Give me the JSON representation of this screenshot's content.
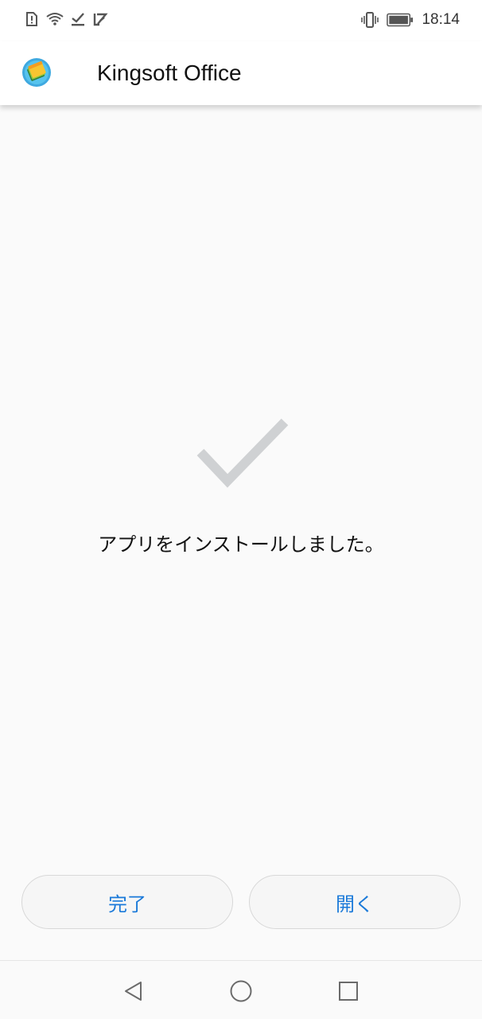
{
  "status_bar": {
    "time": "18:14",
    "left_icons": [
      "sim-alert-icon",
      "wifi-icon",
      "download-done-icon",
      "notification-icon"
    ],
    "right_icons": [
      "vibrate-icon",
      "battery-icon"
    ]
  },
  "header": {
    "app_name": "Kingsoft Office",
    "logo_icon": "app-logo-icon"
  },
  "main": {
    "status_icon": "checkmark-icon",
    "message": "アプリをインストールしました。"
  },
  "actions": {
    "done_label": "完了",
    "open_label": "開く"
  },
  "colors": {
    "accent": "#1a79d9",
    "background": "#fafafa",
    "check": "#cfd1d3"
  },
  "nav_bar": {
    "buttons": [
      "back-icon",
      "home-icon",
      "recents-icon"
    ]
  }
}
